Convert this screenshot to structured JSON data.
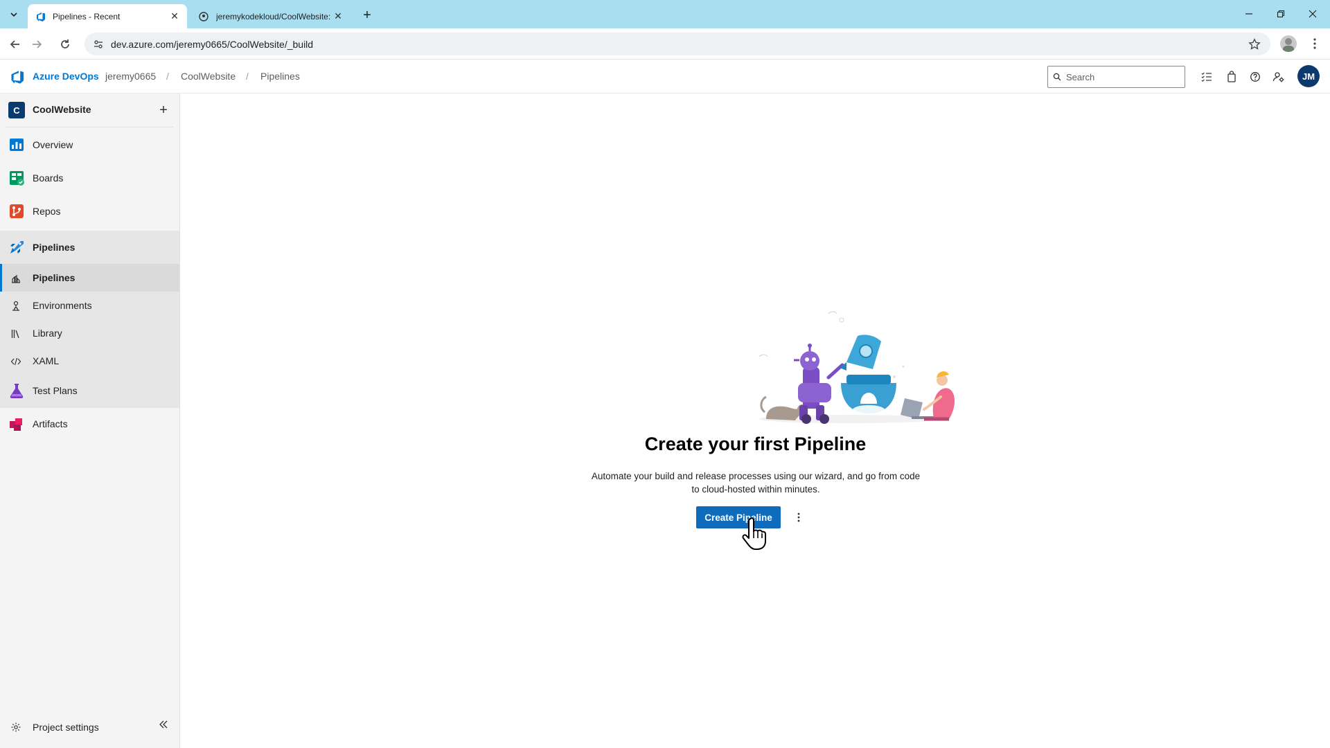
{
  "browser": {
    "tabs": [
      {
        "title": "Pipelines - Recent",
        "active": true
      },
      {
        "title": "jeremykodekloud/CoolWebsite:",
        "active": false
      }
    ],
    "url": "dev.azure.com/jeremy0665/CoolWebsite/_build"
  },
  "header": {
    "brand": "Azure DevOps",
    "breadcrumbs": [
      "jeremy0665",
      "CoolWebsite",
      "Pipelines"
    ],
    "breadcrumb_separator": "/",
    "search_placeholder": "Search",
    "avatar_initials": "JM"
  },
  "sidebar": {
    "project_initial": "C",
    "project_name": "CoolWebsite",
    "items": [
      {
        "label": "Overview",
        "icon": "overview-icon"
      },
      {
        "label": "Boards",
        "icon": "boards-icon"
      },
      {
        "label": "Repos",
        "icon": "repos-icon"
      },
      {
        "label": "Pipelines",
        "icon": "pipelines-icon"
      },
      {
        "label": "Test Plans",
        "icon": "test-plans-icon"
      },
      {
        "label": "Artifacts",
        "icon": "artifacts-icon"
      }
    ],
    "pipelines_sub": [
      {
        "label": "Pipelines",
        "icon": "pipelines-sub-icon",
        "selected": true
      },
      {
        "label": "Environments",
        "icon": "environments-icon"
      },
      {
        "label": "Library",
        "icon": "library-icon"
      },
      {
        "label": "XAML",
        "icon": "xaml-icon"
      }
    ],
    "settings_label": "Project settings"
  },
  "main": {
    "title": "Create your first Pipeline",
    "description": "Automate your build and release processes using our wizard, and go from code to cloud-hosted within minutes.",
    "create_button": "Create Pipeline"
  },
  "colors": {
    "accent": "#0078d4",
    "primary_button": "#0f6cbd",
    "tabbar": "#a8def0"
  }
}
